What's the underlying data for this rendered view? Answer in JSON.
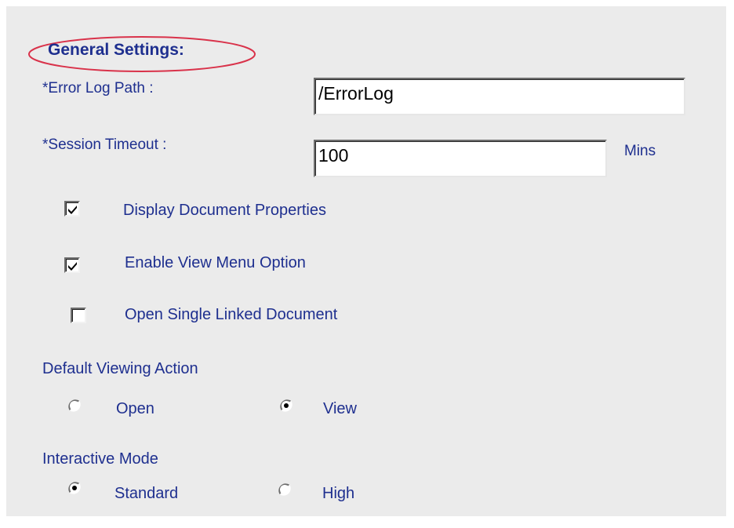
{
  "section": {
    "title": "General Settings:"
  },
  "fields": {
    "error_log_path": {
      "label": "*Error Log Path :",
      "value": "/ErrorLog"
    },
    "session_timeout": {
      "label": "*Session Timeout :",
      "value": "100",
      "unit": "Mins"
    }
  },
  "checkboxes": [
    {
      "label": "Display Document Properties",
      "checked": true
    },
    {
      "label": "Enable View Menu Option",
      "checked": true
    },
    {
      "label": "Open Single Linked Document",
      "checked": false
    }
  ],
  "default_viewing_action": {
    "label": "Default Viewing Action",
    "options": [
      {
        "label": "Open",
        "selected": false
      },
      {
        "label": "View",
        "selected": true
      }
    ]
  },
  "interactive_mode": {
    "label": "Interactive Mode",
    "options": [
      {
        "label": "Standard",
        "selected": true
      },
      {
        "label": "High",
        "selected": false
      }
    ]
  },
  "colors": {
    "label_text": "#1e2f8f",
    "panel_background": "#ebebeb",
    "highlight_ellipse": "#d9324a"
  }
}
